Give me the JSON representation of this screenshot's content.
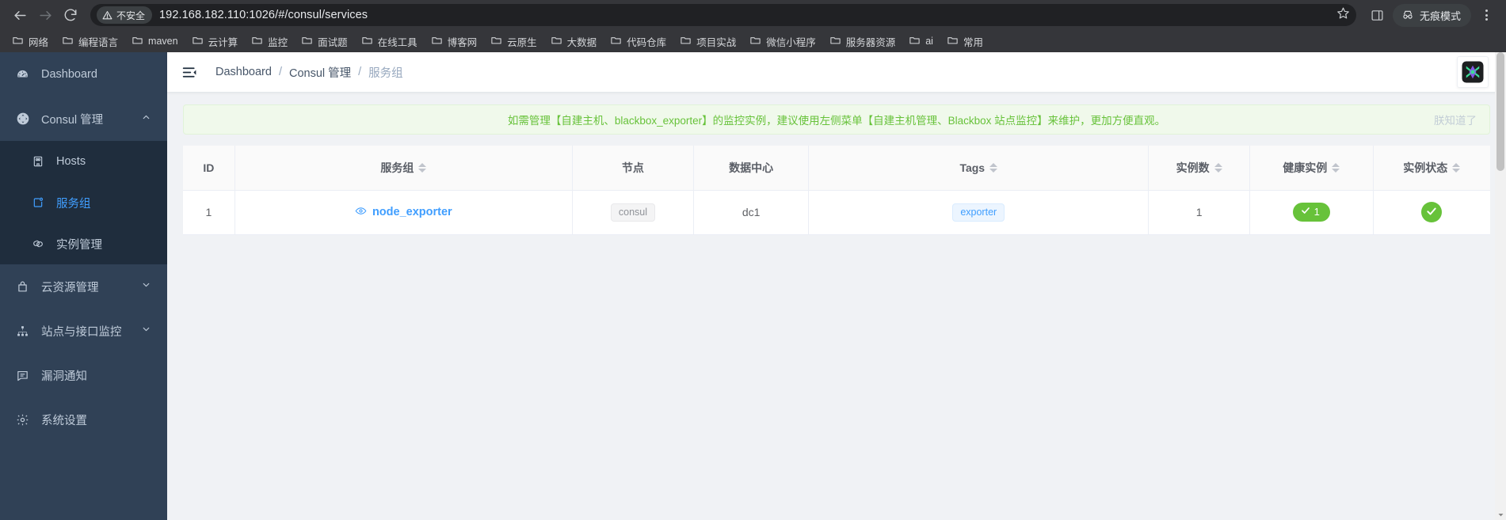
{
  "browser": {
    "back_label": "back",
    "forward_label": "forward",
    "reload_label": "reload",
    "security_label": "不安全",
    "url": "192.168.182.110:1026/#/consul/services",
    "bookmark_label": "bookmark",
    "sidepanel_label": "side panel",
    "incognito_label": "无痕模式",
    "menu_label": "menu",
    "bookmarks": [
      {
        "label": "网络"
      },
      {
        "label": "编程语言"
      },
      {
        "label": "maven"
      },
      {
        "label": "云计算"
      },
      {
        "label": "监控"
      },
      {
        "label": "面试题"
      },
      {
        "label": "在线工具"
      },
      {
        "label": "博客网"
      },
      {
        "label": "云原生"
      },
      {
        "label": "大数据"
      },
      {
        "label": "代码仓库"
      },
      {
        "label": "项目实战"
      },
      {
        "label": "微信小程序"
      },
      {
        "label": "服务器资源"
      },
      {
        "label": "ai"
      },
      {
        "label": "常用"
      }
    ]
  },
  "sidebar": {
    "items": [
      {
        "label": "Dashboard",
        "icon": "dashboard-icon",
        "expandable": false,
        "active": false
      },
      {
        "label": "Consul 管理",
        "icon": "consul-icon",
        "expandable": true,
        "active": true
      },
      {
        "label": "云资源管理",
        "icon": "briefcase-icon",
        "expandable": true,
        "active": false
      },
      {
        "label": "站点与接口监控",
        "icon": "sitemap-icon",
        "expandable": true,
        "active": false
      },
      {
        "label": "漏洞通知",
        "icon": "message-icon",
        "expandable": false,
        "active": false
      },
      {
        "label": "系统设置",
        "icon": "gear-icon",
        "expandable": false,
        "active": false
      }
    ],
    "submenu": [
      {
        "label": "Hosts",
        "icon": "host-icon",
        "active": false
      },
      {
        "label": "服务组",
        "icon": "service-group-icon",
        "active": true
      },
      {
        "label": "实例管理",
        "icon": "instance-icon",
        "active": false
      }
    ]
  },
  "topbar": {
    "hamburger_label": "collapse-sidebar",
    "breadcrumb": [
      {
        "label": "Dashboard",
        "muted": false
      },
      {
        "label": "Consul 管理",
        "muted": false
      },
      {
        "label": "服务组",
        "muted": true
      }
    ],
    "separator": "/",
    "logo_label": "app-logo"
  },
  "alert": {
    "text": "如需管理【自建主机、blackbox_exporter】的监控实例，建议使用左侧菜单【自建主机管理、Blackbox 站点监控】来维护，更加方便直观。",
    "close_label": "朕知道了",
    "color": "#67c23a",
    "background": "#f0f9eb"
  },
  "table": {
    "columns": [
      {
        "label": "ID",
        "sortable": false
      },
      {
        "label": "服务组",
        "sortable": true
      },
      {
        "label": "节点",
        "sortable": false
      },
      {
        "label": "数据中心",
        "sortable": false
      },
      {
        "label": "Tags",
        "sortable": true
      },
      {
        "label": "实例数",
        "sortable": true
      },
      {
        "label": "健康实例",
        "sortable": true
      },
      {
        "label": "实例状态",
        "sortable": true
      }
    ],
    "rows": [
      {
        "id": "1",
        "service_group": "node_exporter",
        "service_group_icon": "eye-icon",
        "node": "consul",
        "datacenter": "dc1",
        "tags": [
          "exporter"
        ],
        "instance_count": "1",
        "healthy_count": "1",
        "healthy_icon": "check-icon",
        "status_icon": "check-icon"
      }
    ]
  },
  "colors": {
    "accent": "#409eff",
    "success": "#67c23a",
    "sidebar_bg": "#304156",
    "submenu_bg": "#1f2d3d",
    "page_bg": "#f0f2f5"
  }
}
